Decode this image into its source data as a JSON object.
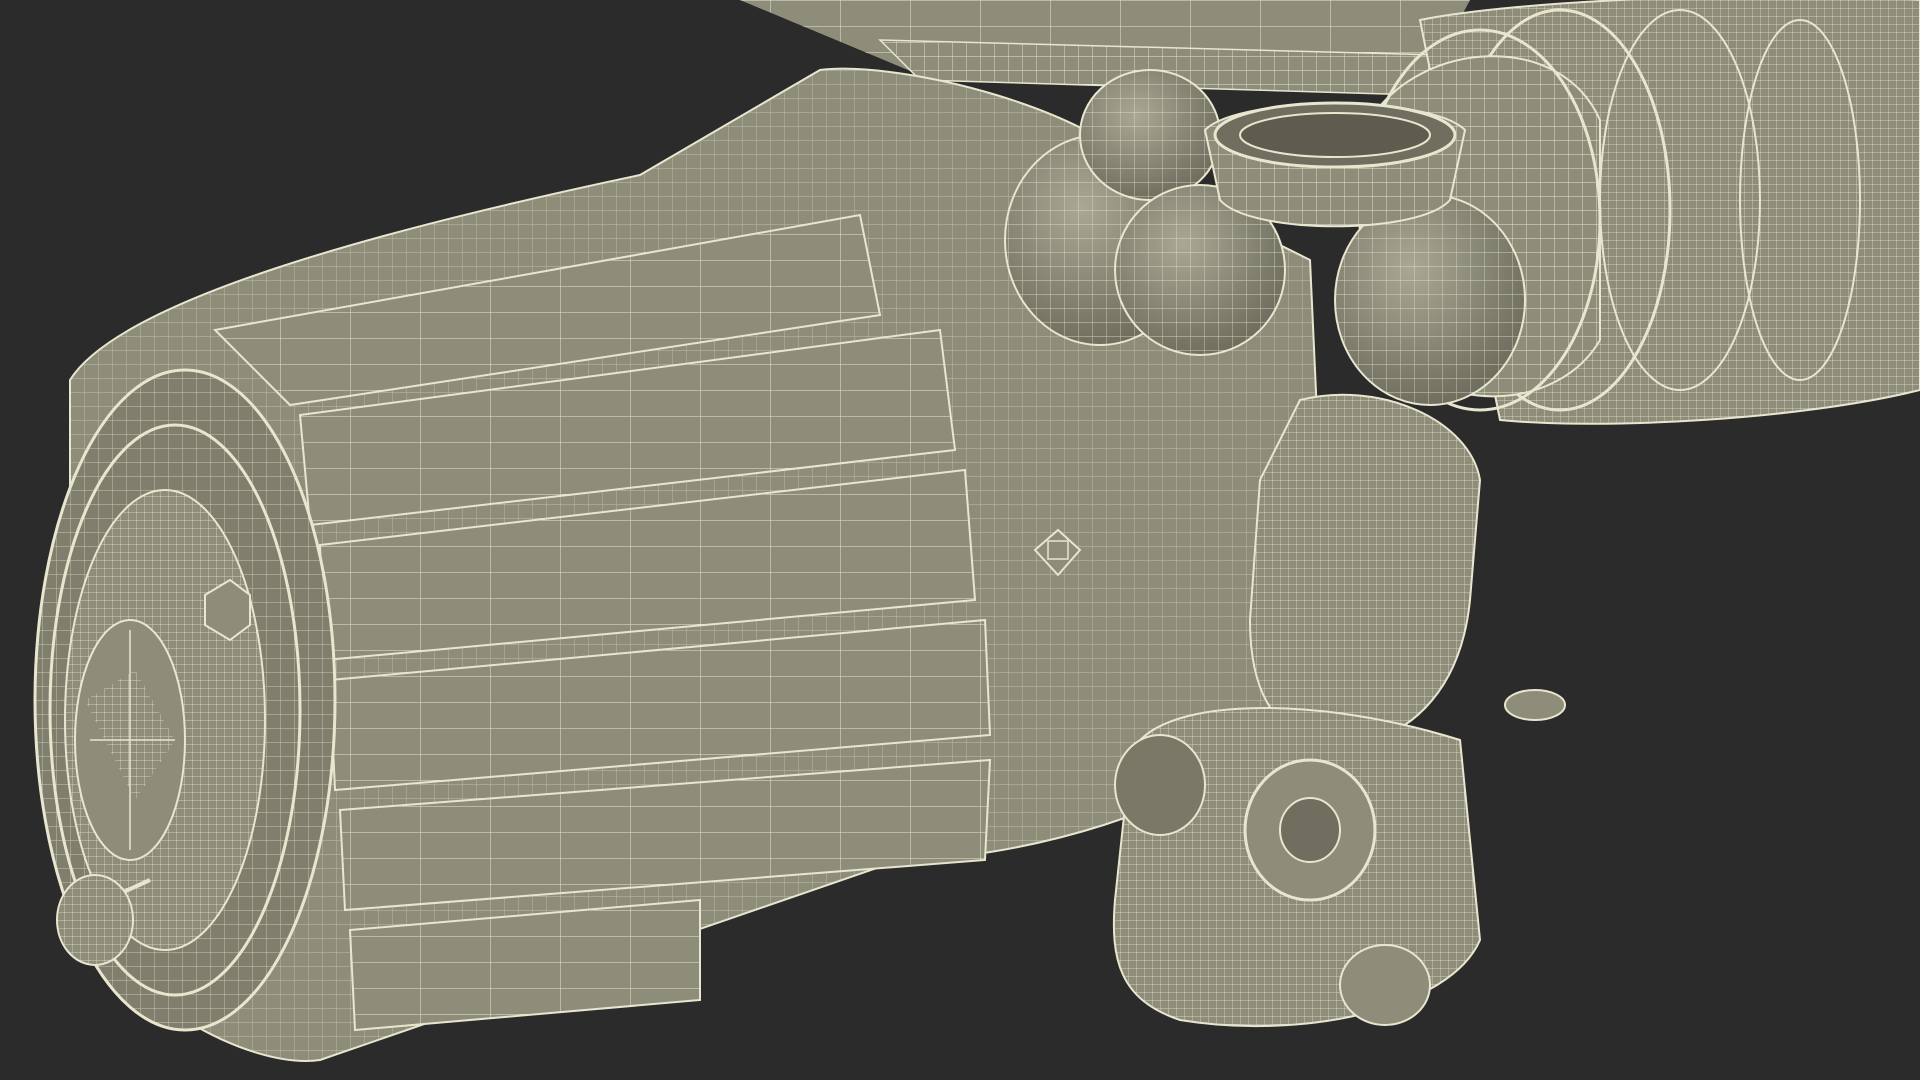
{
  "scene": {
    "subject": "space-station-module-wireframe",
    "colors": {
      "background": "#2b2b2b",
      "surface": "#8e8d7a",
      "surface_light": "#a3a28d",
      "surface_dark": "#6f6e5f",
      "wire": "#e8e6cf"
    }
  }
}
